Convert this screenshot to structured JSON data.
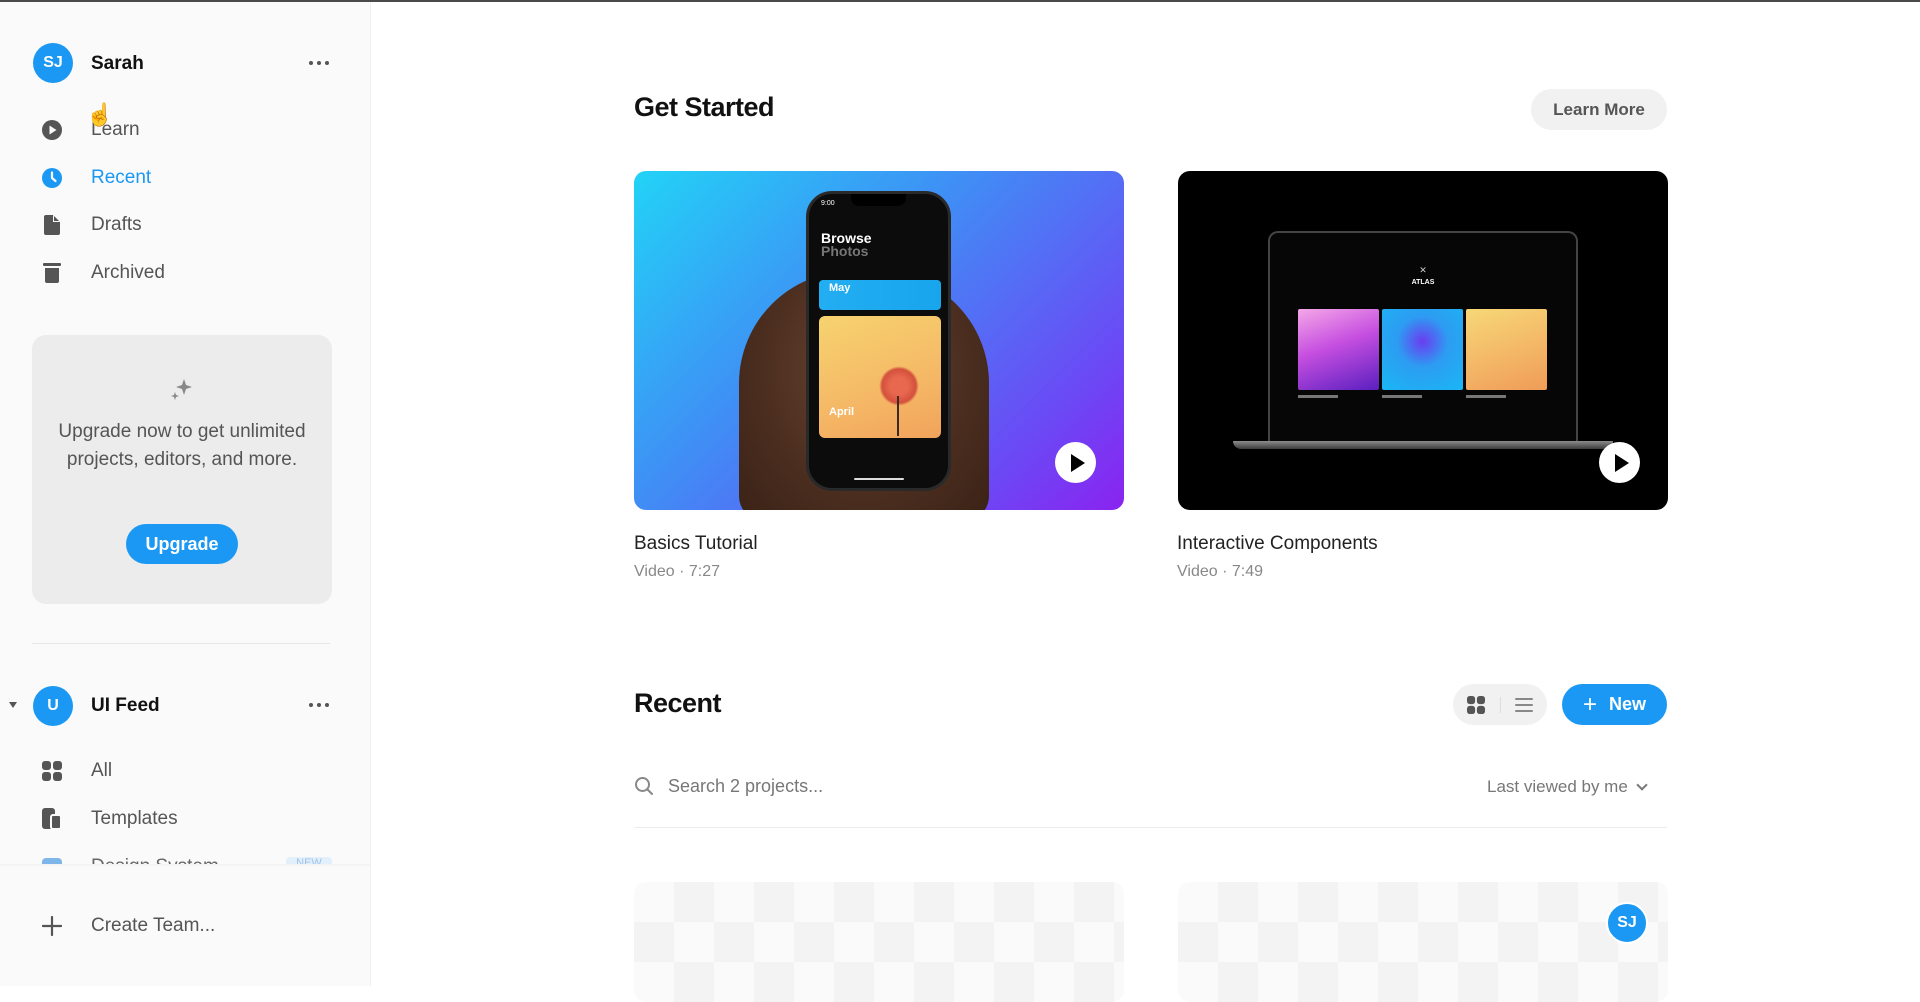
{
  "sidebar": {
    "user": {
      "initials": "SJ",
      "name": "Sarah",
      "menu_icon": "more-horizontal-icon"
    },
    "nav_items": [
      {
        "label": "Learn",
        "icon": "play-circle-icon",
        "active": false
      },
      {
        "label": "Recent",
        "icon": "clock-icon",
        "active": true
      },
      {
        "label": "Drafts",
        "icon": "file-icon",
        "active": false
      },
      {
        "label": "Archived",
        "icon": "archive-icon",
        "active": false
      }
    ],
    "upgrade_card": {
      "icon": "sparkle-icon",
      "text": "Upgrade now to get unlimited projects, editors, and more.",
      "button_label": "Upgrade"
    },
    "team": {
      "initials": "U",
      "name": "UI Feed",
      "expanded": true,
      "items": [
        {
          "label": "All",
          "icon": "grid-icon"
        },
        {
          "label": "Templates",
          "icon": "templates-icon"
        },
        {
          "label": "Design System",
          "icon": "design-system-icon",
          "badge": "NEW"
        }
      ]
    },
    "create_team_label": "Create Team..."
  },
  "main": {
    "get_started": {
      "title": "Get Started",
      "learn_more_label": "Learn More",
      "videos": [
        {
          "title": "Basics Tutorial",
          "subtitle": "Video · 7:27",
          "thumb": {
            "heading": "Browse",
            "subheading": "Photos",
            "tile1": "May",
            "tile2": "April",
            "time": "9:00"
          }
        },
        {
          "title": "Interactive Components",
          "subtitle": "Video · 7:49",
          "thumb": {
            "brand": "ATLAS"
          }
        }
      ]
    },
    "recent": {
      "title": "Recent",
      "view_modes": [
        "grid",
        "list"
      ],
      "active_view": "grid",
      "new_button_label": "New",
      "search_placeholder": "Search 2 projects...",
      "sort_label": "Last viewed by me",
      "projects": [
        {
          "owner_initials": ""
        },
        {
          "owner_initials": "SJ"
        }
      ]
    }
  },
  "colors": {
    "accent": "#1a98f3",
    "sidebar_bg": "#fafafa",
    "card_bg": "#ececec"
  }
}
